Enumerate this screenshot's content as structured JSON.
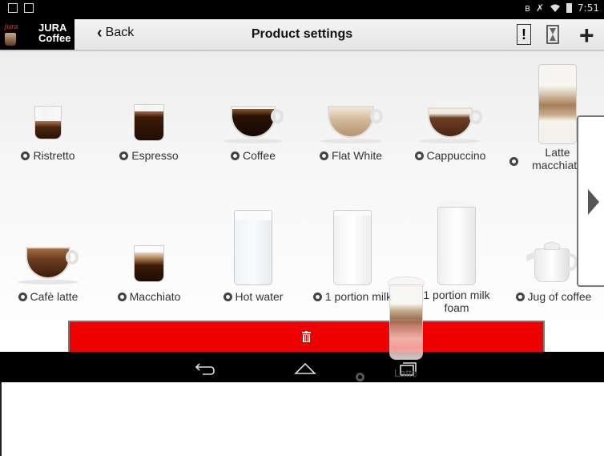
{
  "status_bar": {
    "time": "7:51",
    "icons": [
      "image-icon",
      "download-icon",
      "bluetooth-icon",
      "mute-icon",
      "wifi-icon",
      "battery-icon"
    ]
  },
  "app_bar": {
    "brand_logo": "jura",
    "brand_line1": "JURA",
    "brand_line2": "Coffee",
    "back_label": "Back",
    "title": "Product settings"
  },
  "products": [
    {
      "label": "Ristretto"
    },
    {
      "label": "Espresso"
    },
    {
      "label": "Coffee"
    },
    {
      "label": "Flat White"
    },
    {
      "label": "Cappuccino"
    },
    {
      "label": "Latte",
      "label2": "macchiato"
    },
    {
      "label": "Cafè latte"
    },
    {
      "label": "Macchiato"
    },
    {
      "label": "Hot water"
    },
    {
      "label": "1 portion milk"
    },
    {
      "label": "1 portion milk",
      "label2": "foam"
    },
    {
      "label": "Jug of coffee"
    }
  ],
  "drag_ghost": {
    "label": "Latte"
  },
  "colors": {
    "delete_bar": "#ee0000",
    "status_bar": "#000000",
    "brand_red": "#d9141b"
  }
}
